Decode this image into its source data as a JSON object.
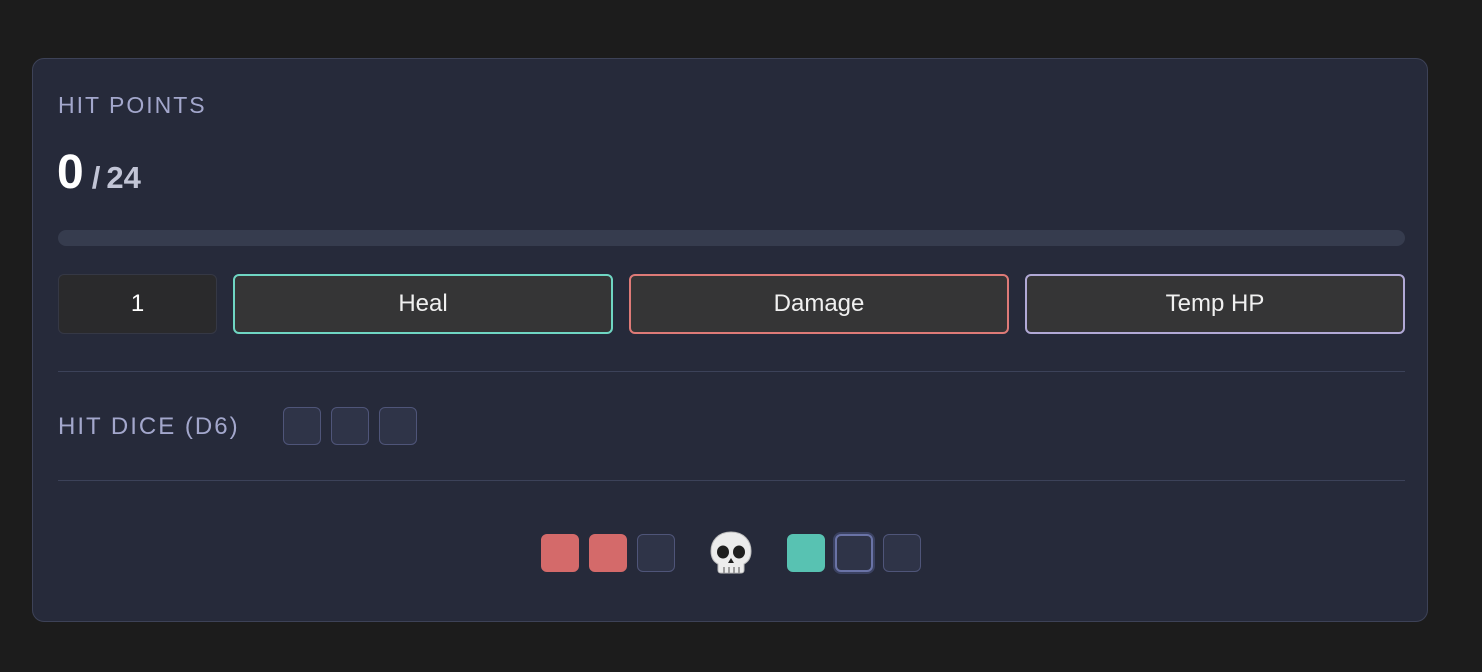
{
  "hit_points": {
    "title": "HIT POINTS",
    "current": "0",
    "separator": "/",
    "max": "24",
    "fill_fraction": 0
  },
  "controls": {
    "amount_value": "1",
    "heal_label": "Heal",
    "damage_label": "Damage",
    "temp_label": "Temp HP"
  },
  "hit_dice": {
    "label": "HIT DICE (D6)",
    "total": 3,
    "used": 0
  },
  "death_saves": {
    "failures_marked": 2,
    "successes_marked": 1,
    "icon": "skull-icon"
  },
  "colors": {
    "heal": "#6fd6c3",
    "damage": "#de7a77",
    "temp": "#b1a9d6",
    "failure": "#d46a6a",
    "success": "#58c2b2"
  }
}
